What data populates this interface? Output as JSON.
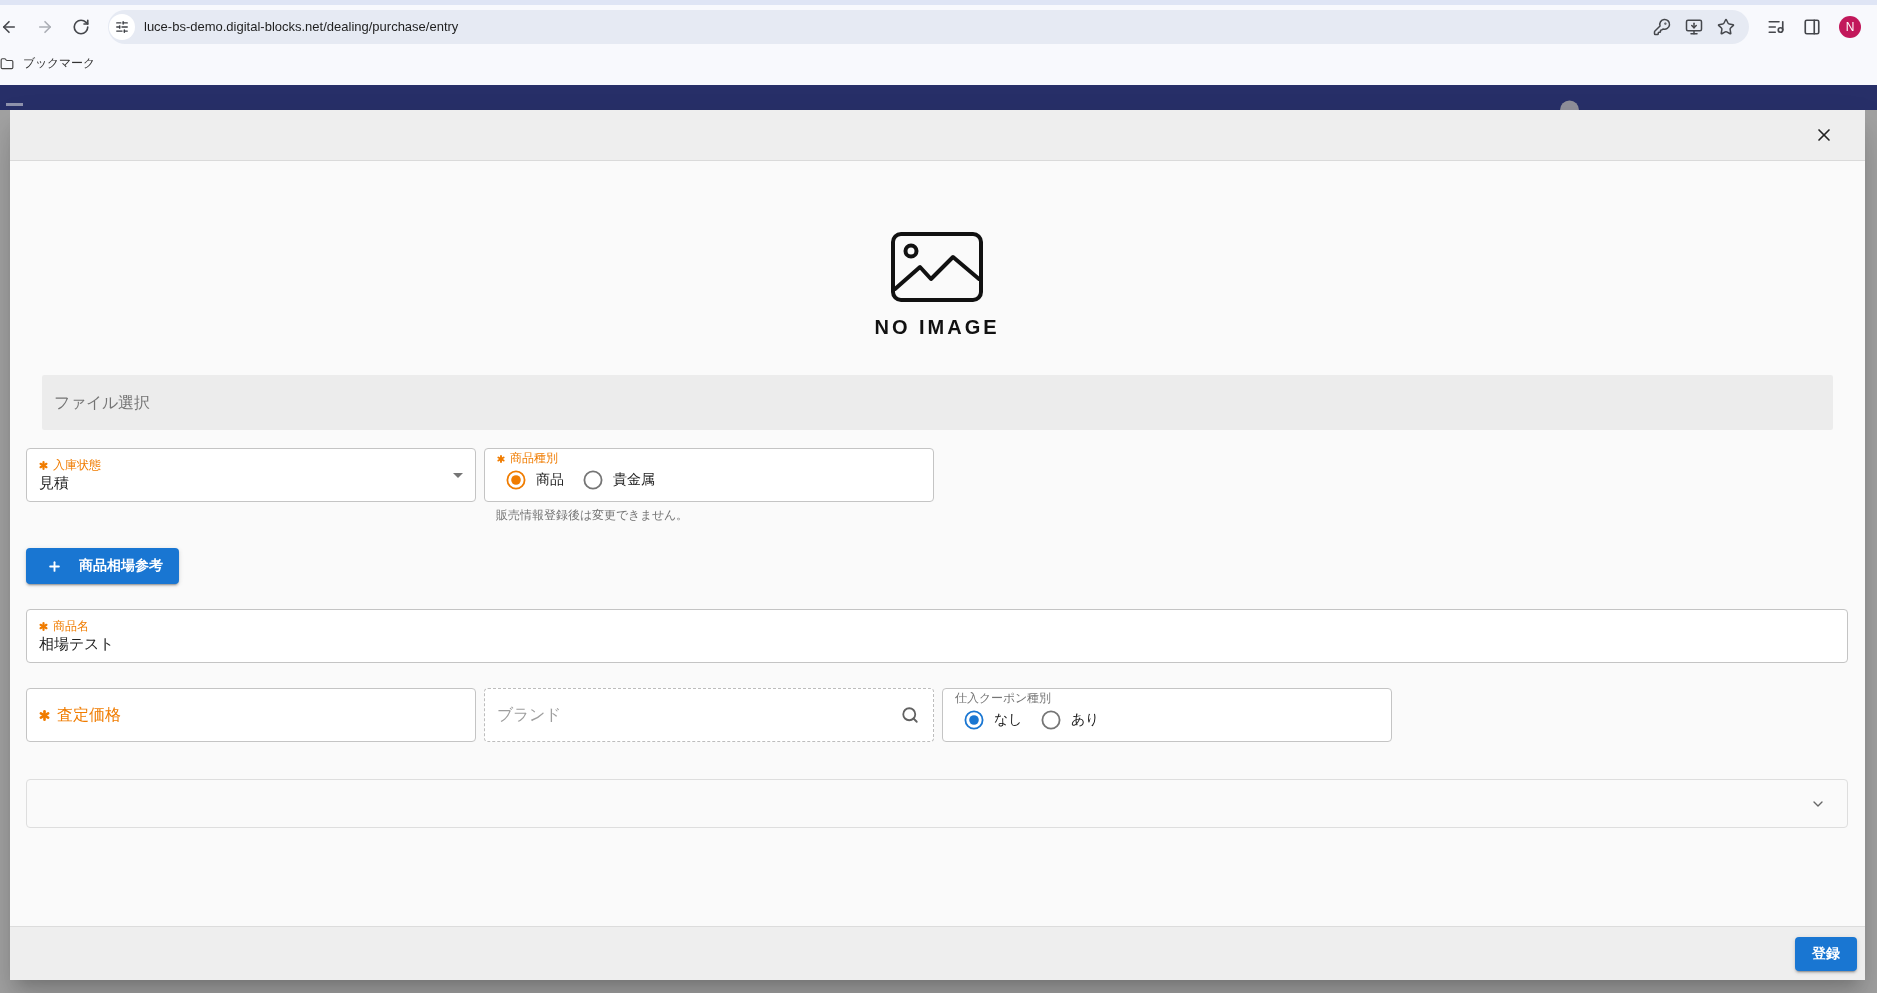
{
  "browser": {
    "nav": [
      {
        "kind": "back",
        "disabled": false
      },
      {
        "kind": "forward",
        "disabled": true
      },
      {
        "kind": "reload",
        "disabled": false
      }
    ],
    "url": "luce-bs-demo.digital-blocks.net/dealing/purchase/entry",
    "profile": "N",
    "bookmarks": [
      {
        "label": "ブックマーク"
      }
    ]
  },
  "dialog": {
    "image": {
      "caption": "NO IMAGE"
    },
    "file_picker": {
      "placeholder": "ファイル選択"
    },
    "rows": [
      {
        "kind": "fields",
        "fields": [
          {
            "kind": "select",
            "label": "入庫状態",
            "required": true,
            "value": "見積"
          },
          {
            "kind": "radio",
            "label": "商品種別",
            "required": true,
            "hint": "販売情報登録後は変更できません。",
            "options": [
              {
                "label": "商品",
                "selected": true
              },
              {
                "label": "貴金属",
                "selected": false
              }
            ]
          }
        ]
      },
      {
        "kind": "button",
        "label": "商品相場参考"
      },
      {
        "kind": "fields",
        "fields": [
          {
            "kind": "text",
            "label": "商品名",
            "required": true,
            "value": "相場テスト"
          }
        ]
      },
      {
        "kind": "fields",
        "fields": [
          {
            "kind": "text",
            "label": "査定価格",
            "required": true
          },
          {
            "kind": "search",
            "placeholder": "ブランド"
          },
          {
            "kind": "radio",
            "label": "仕入クーポン種別",
            "required": false,
            "options": [
              {
                "label": "なし",
                "selected": true
              },
              {
                "label": "あり",
                "selected": false
              }
            ]
          }
        ]
      },
      {
        "kind": "accordion",
        "expanded": false
      }
    ],
    "footer": {
      "buttons": [
        {
          "label": "登録"
        }
      ]
    }
  }
}
